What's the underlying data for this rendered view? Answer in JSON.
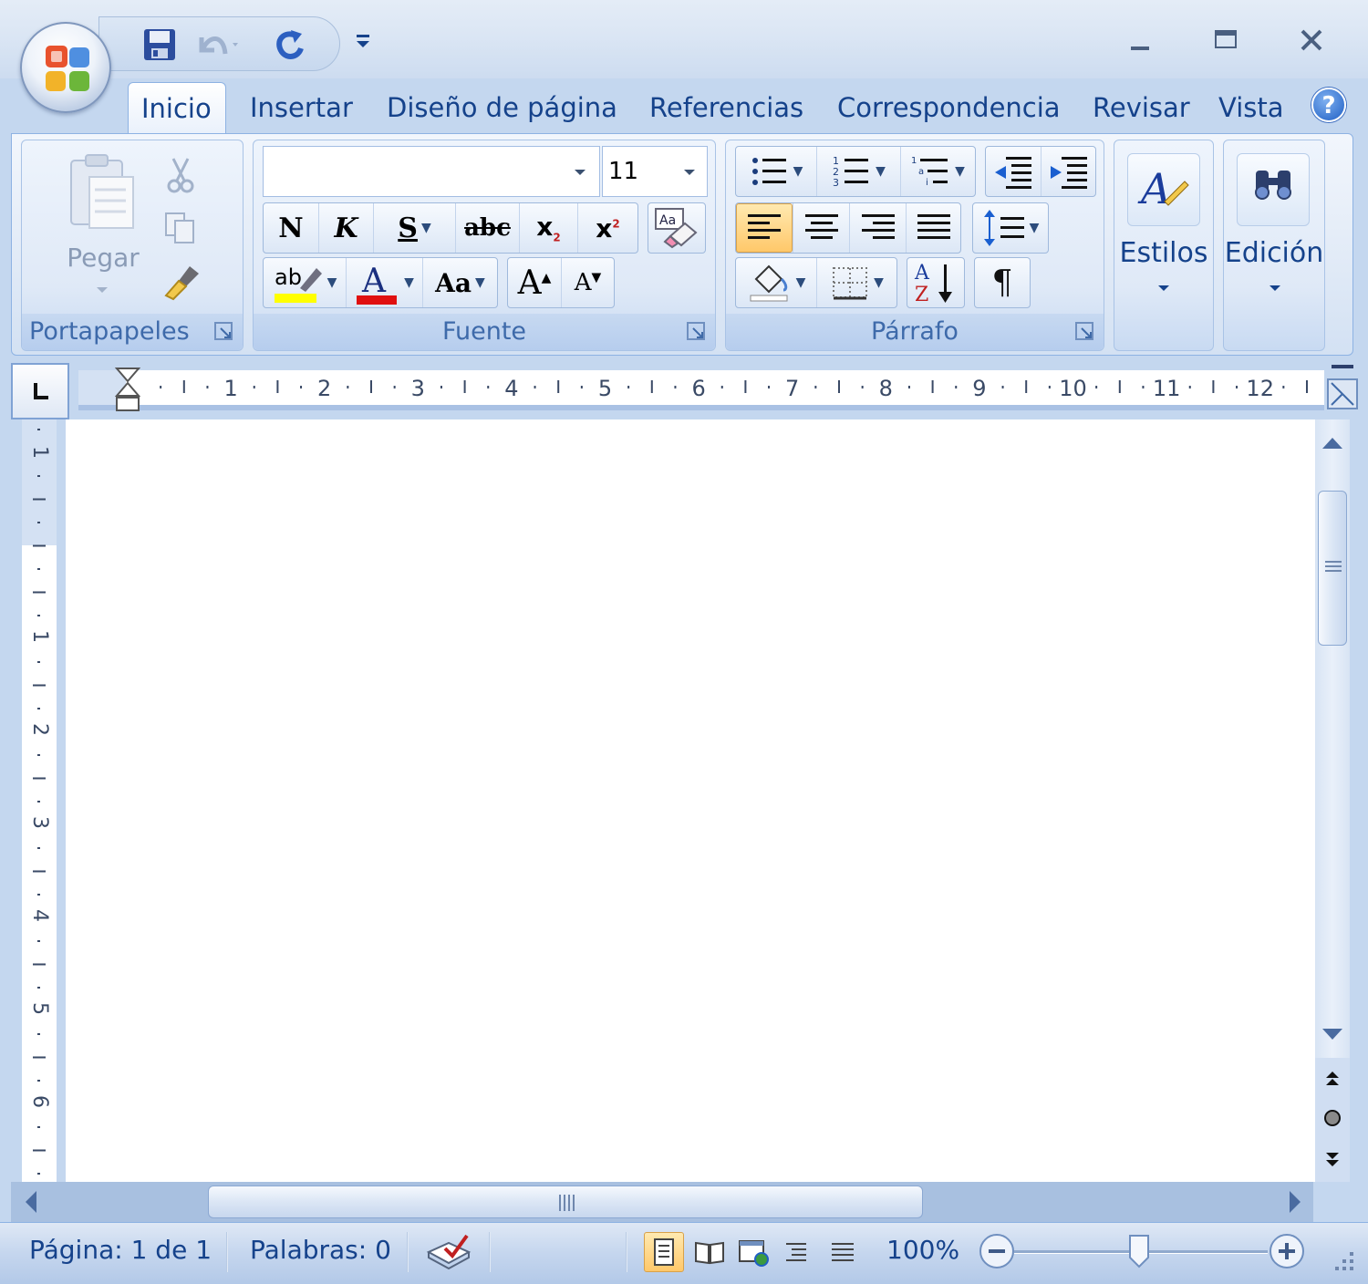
{
  "title_bar": {
    "quick_access": [
      {
        "icon": "save-icon"
      },
      {
        "icon": "undo-icon"
      },
      {
        "icon": "redo-icon"
      }
    ],
    "window_controls": [
      "minimize-icon",
      "maximize-icon",
      "close-icon"
    ]
  },
  "tabs": [
    {
      "label": "Inicio",
      "active": true
    },
    {
      "label": "Insertar"
    },
    {
      "label": "Diseño de página"
    },
    {
      "label": "Referencias"
    },
    {
      "label": "Correspondencia"
    },
    {
      "label": "Revisar"
    },
    {
      "label": "Vista"
    }
  ],
  "ribbon": {
    "clipboard": {
      "label": "Portapapeles",
      "paste_label": "Pegar"
    },
    "font": {
      "label": "Fuente",
      "font_name": "",
      "font_size": "11",
      "bold": "N",
      "italic": "K",
      "underline": "S",
      "strike": "abc",
      "subscript": "x",
      "superscript": "x",
      "change_case": "Aa",
      "grow": "A",
      "shrink": "A",
      "font_color_letter": "A",
      "highlight_letters": "ab",
      "highlight_color": "#ffff00",
      "font_color": "#e01010"
    },
    "paragraph": {
      "label": "Párrafo",
      "sort_a": "A",
      "sort_z": "Z",
      "pilcrow": "¶"
    },
    "styles": {
      "label": "Estilos"
    },
    "editing": {
      "label": "Edición"
    }
  },
  "ruler": {
    "h_numbers": [
      "1",
      "2",
      "3",
      "4",
      "5",
      "6",
      "7",
      "8",
      "9",
      "10",
      "11",
      "12"
    ],
    "v_numbers": [
      "1",
      "1",
      "2",
      "3",
      "4",
      "5",
      "6"
    ]
  },
  "status": {
    "page": "Página: 1 de 1",
    "words": "Palabras: 0",
    "zoom": "100%"
  },
  "colors": {
    "accent": "#15428b",
    "ribbon_border": "#8db2e3",
    "active_button": "#ffd48a"
  }
}
